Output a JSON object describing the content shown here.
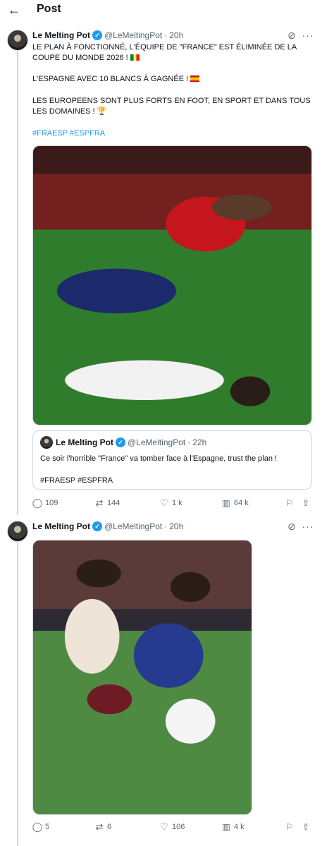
{
  "header": {
    "title": "Post"
  },
  "tweet1": {
    "name": "Le Melting Pot",
    "handle": "@LeMeltingPot",
    "time": "20h",
    "line1": "LE PLAN À FONCTIONNÉ, L'ÉQUIPE DE \"FRANCE\" EST ÉLIMINÉE DE LA COUPE DU MONDE 2026 !",
    "line2": "L'ESPAGNE AVEC 10 BLANCS À GAGNÉE !",
    "line3": "LES EUROPEENS SONT PLUS FORTS EN FOOT, EN SPORT ET DANS TOUS LES DOMAINES !",
    "hashtags": "#FRAESP #ESPFRA",
    "quote": {
      "name": "Le Melting Pot",
      "handle": "@LeMeltingPot",
      "time": "22h",
      "text": "Ce soir l'horrible \"France\" va tomber face à l'Espagne, trust the plan !",
      "hashtags": "#FRAESP #ESPFRA"
    },
    "stats": {
      "replies": "109",
      "reposts": "144",
      "likes": "1 k",
      "views": "64 k"
    }
  },
  "tweet2": {
    "name": "Le Melting Pot",
    "handle": "@LeMeltingPot",
    "time": "20h",
    "stats": {
      "replies": "5",
      "reposts": "6",
      "likes": "106",
      "views": "4 k"
    }
  },
  "icons": {
    "back": "arrow-left-icon",
    "verified": "verified-badge-icon",
    "grok": "grok-icon",
    "more": "more-icon",
    "reply": "reply-icon",
    "repost": "repost-icon",
    "like": "heart-icon",
    "views": "views-icon",
    "bookmark": "bookmark-icon",
    "share": "share-icon"
  },
  "colors": {
    "link": "#1d9bf0",
    "muted": "#536471",
    "text": "#0f1419",
    "border": "#cfd9de"
  }
}
